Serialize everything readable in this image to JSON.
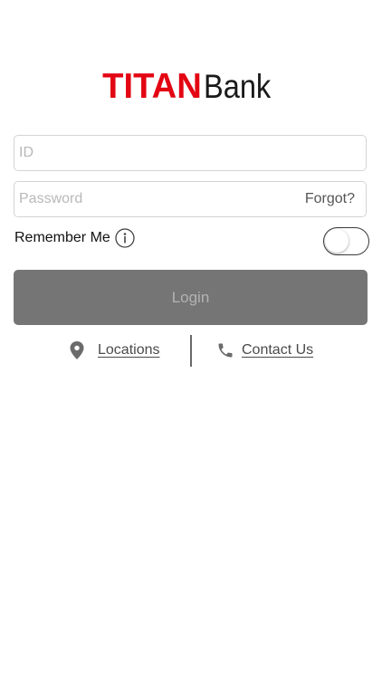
{
  "logo": {
    "part1": "TITAN",
    "part2": "Bank",
    "colors": {
      "part1": "#e30613",
      "part2": "#1a1a1a"
    }
  },
  "form": {
    "id_placeholder": "ID",
    "password_placeholder": "Password",
    "forgot_label": "Forgot?",
    "remember_label": "Remember Me",
    "remember_on": false,
    "login_label": "Login"
  },
  "links": {
    "locations": {
      "label": "Locations",
      "icon": "location-pin-icon"
    },
    "contact": {
      "label": "Contact Us",
      "icon": "phone-icon"
    }
  },
  "colors": {
    "login_button_bg": "#757575",
    "login_button_text": "#b3b3b3",
    "accent_red": "#e30613"
  }
}
